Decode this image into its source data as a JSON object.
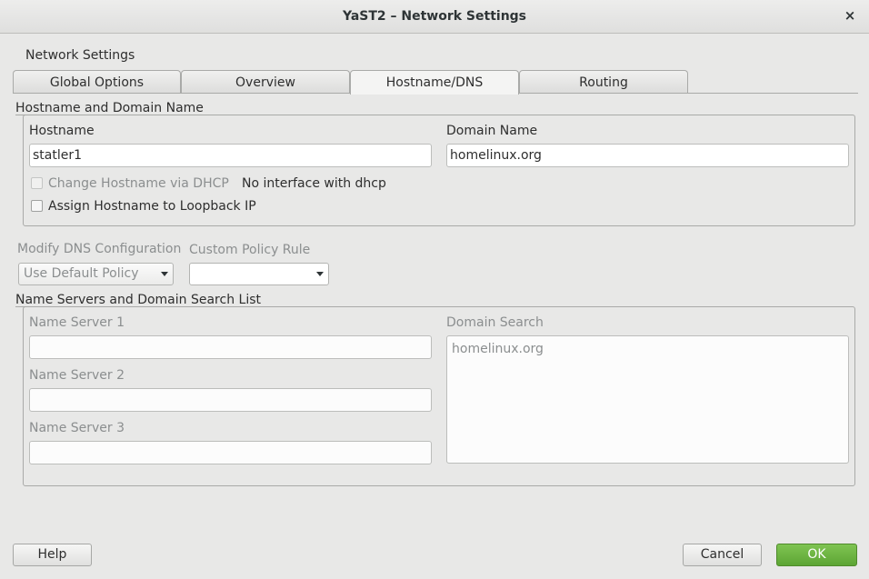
{
  "window": {
    "title": "YaST2 – Network Settings",
    "close_icon": "close-icon",
    "close_glyph": "×"
  },
  "page": {
    "heading": "Network Settings"
  },
  "tabs": [
    {
      "label": "Global Options",
      "active": false
    },
    {
      "label": "Overview",
      "active": false
    },
    {
      "label": "Hostname/DNS",
      "active": true
    },
    {
      "label": "Routing",
      "active": false
    }
  ],
  "hostname_section": {
    "title": "Hostname and Domain Name",
    "hostname_label": "Hostname",
    "hostname_value": "statler1",
    "domain_label": "Domain Name",
    "domain_value": "homelinux.org",
    "dhcp_checkbox_label": "Change Hostname via DHCP",
    "dhcp_checked": false,
    "dhcp_note": "No interface with dhcp",
    "loopback_checkbox_label": "Assign Hostname to Loopback IP",
    "loopback_checked": false
  },
  "dns_config": {
    "modify_label": "Modify DNS Configuration",
    "modify_value": "Use Default Policy",
    "policy_label": "Custom Policy Rule",
    "policy_value": ""
  },
  "nameservers_section": {
    "title": "Name Servers and Domain Search List",
    "ns1_label": "Name Server 1",
    "ns1_value": "",
    "ns2_label": "Name Server 2",
    "ns2_value": "",
    "ns3_label": "Name Server 3",
    "ns3_value": "",
    "search_label": "Domain Search",
    "search_value": "homelinux.org"
  },
  "buttons": {
    "help": "Help",
    "cancel": "Cancel",
    "ok": "OK"
  },
  "colors": {
    "window_bg": "#e8e8e7",
    "ok_button": "#6db33f",
    "frame_border": "#a9aaa8"
  }
}
